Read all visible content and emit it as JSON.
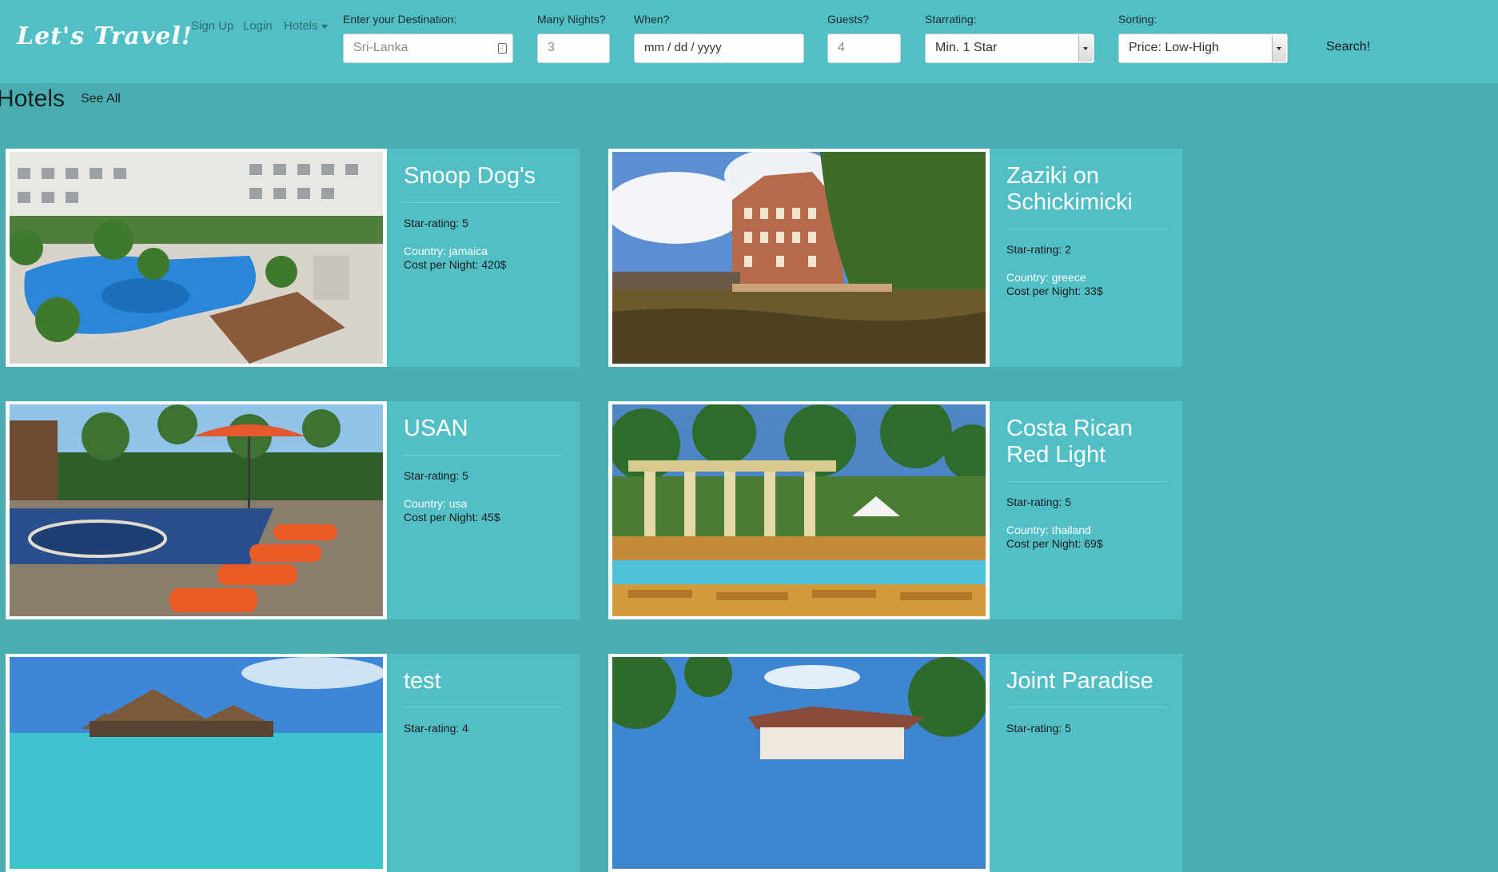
{
  "brand": "Let's Travel!",
  "nav": {
    "signup": "Sign Up",
    "login": "Login",
    "hotels": "Hotels"
  },
  "search": {
    "destination": {
      "label": "Enter your Destination:",
      "placeholder": "Sri-Lanka"
    },
    "nights": {
      "label": "Many Nights?",
      "placeholder": "3"
    },
    "when": {
      "label": "When?",
      "placeholder": "mm / dd / yyyy"
    },
    "guests": {
      "label": "Guests?",
      "placeholder": "4"
    },
    "starrating": {
      "label": "Starrating:",
      "value": "Min. 1 Star"
    },
    "sorting": {
      "label": "Sorting:",
      "value": "Price: Low-High"
    },
    "submit": "Search!"
  },
  "section": {
    "title": "Hotels",
    "see_all": "See All"
  },
  "hotels": [
    {
      "name": "Snoop Dog's",
      "stars": "Star-rating: 5",
      "country": "Country: jamaica",
      "cost": "Cost per Night: 420$"
    },
    {
      "name": "Zaziki on Schickimicki",
      "stars": "Star-rating: 2",
      "country": "Country: greece",
      "cost": "Cost per Night: 33$"
    },
    {
      "name": "USAN",
      "stars": "Star-rating: 5",
      "country": "Country: usa",
      "cost": "Cost per Night: 45$"
    },
    {
      "name": "Costa Rican Red Light",
      "stars": "Star-rating: 5",
      "country": "Country: thailand",
      "cost": "Cost per Night: 69$"
    },
    {
      "name": "test",
      "stars": "Star-rating: 4",
      "country": "",
      "cost": ""
    },
    {
      "name": "Joint Paradise",
      "stars": "Star-rating: 5",
      "country": "",
      "cost": ""
    }
  ]
}
